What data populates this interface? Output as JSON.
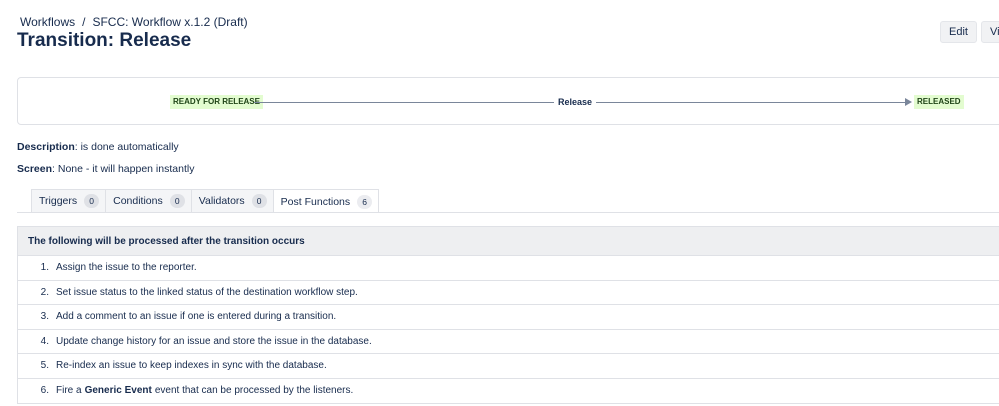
{
  "breadcrumb": {
    "root": "Workflows",
    "separator": "/",
    "current": "SFCC: Workflow x.1.2 (Draft)"
  },
  "page_title": "Transition: Release",
  "actions": {
    "edit": "Edit",
    "view": "View"
  },
  "diagram": {
    "from_status": "READY FOR RELEASE",
    "transition": "Release",
    "to_status": "RELEASED",
    "status_color": "#e3fcd0"
  },
  "description": {
    "label": "Description",
    "value": ": is done automatically"
  },
  "screen": {
    "label": "Screen",
    "value": ": None - it will happen instantly"
  },
  "tabs": [
    {
      "label": "Triggers",
      "count": "0"
    },
    {
      "label": "Conditions",
      "count": "0"
    },
    {
      "label": "Validators",
      "count": "0"
    },
    {
      "label": "Post Functions",
      "count": "6",
      "active": true
    }
  ],
  "post_functions": {
    "header": "The following will be processed after the transition occurs",
    "items": [
      {
        "num": "1.",
        "text": "Assign the issue to the reporter."
      },
      {
        "num": "2.",
        "text": "Set issue status to the linked status of the destination workflow step."
      },
      {
        "num": "3.",
        "text": "Add a comment to an issue if one is entered during a transition."
      },
      {
        "num": "4.",
        "text": "Update change history for an issue and store the issue in the database."
      },
      {
        "num": "5.",
        "text": "Re-index an issue to keep indexes in sync with the database."
      },
      {
        "num": "6.",
        "pre": "Fire a",
        "bold": "Generic Event",
        "post": "event that can be processed by the listeners."
      }
    ]
  }
}
